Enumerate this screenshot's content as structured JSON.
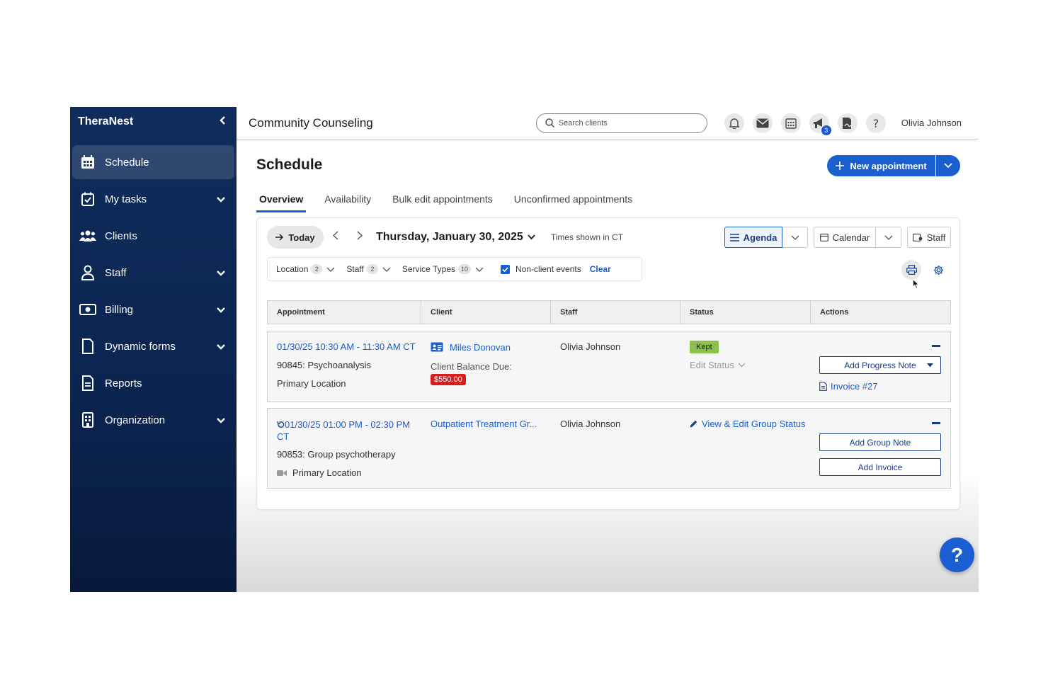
{
  "brand": "TheraNest",
  "sidebar": {
    "items": [
      {
        "label": "Schedule",
        "icon": "calendar-grid-icon",
        "active": true,
        "has_children": false
      },
      {
        "label": "My tasks",
        "icon": "calendar-check-icon",
        "active": false,
        "has_children": true
      },
      {
        "label": "Clients",
        "icon": "people-icon",
        "active": false,
        "has_children": false
      },
      {
        "label": "Staff",
        "icon": "person-icon",
        "active": false,
        "has_children": true
      },
      {
        "label": "Billing",
        "icon": "cash-icon",
        "active": false,
        "has_children": true
      },
      {
        "label": "Dynamic forms",
        "icon": "document-icon",
        "active": false,
        "has_children": true
      },
      {
        "label": "Reports",
        "icon": "report-icon",
        "active": false,
        "has_children": false
      },
      {
        "label": "Organization",
        "icon": "building-icon",
        "active": false,
        "has_children": true
      }
    ]
  },
  "topbar": {
    "org_name": "Community Counseling",
    "search_placeholder": "Search clients",
    "notification_badge": "3",
    "user_name": "Olivia Johnson"
  },
  "page": {
    "title": "Schedule",
    "new_appointment_label": "New appointment",
    "tabs": [
      "Overview",
      "Availability",
      "Bulk edit appointments",
      "Unconfirmed appointments"
    ]
  },
  "toolbar": {
    "today_label": "Today",
    "date_label": "Thursday, January 30, 2025",
    "timezone_note": "Times shown in CT",
    "views": {
      "agenda": "Agenda",
      "calendar": "Calendar",
      "staff": "Staff"
    }
  },
  "filters": {
    "location_label": "Location",
    "location_count": "2",
    "staff_label": "Staff",
    "staff_count": "2",
    "service_types_label": "Service Types",
    "service_types_count": "10",
    "non_client_label": "Non-client events",
    "clear_label": "Clear"
  },
  "table": {
    "headers": [
      "Appointment",
      "Client",
      "Staff",
      "Status",
      "Actions"
    ],
    "rows": [
      {
        "time": "01/30/25 10:30 AM - 11:30 AM CT",
        "service": "90845: Psychoanalysis",
        "location": "Primary Location",
        "client": "Miles Donovan",
        "balance_label": "Client Balance Due:",
        "balance": "$550.00",
        "staff": "Olivia Johnson",
        "status": "Kept",
        "edit_status": "Edit Status",
        "action_primary": "Add Progress Note",
        "invoice": "Invoice #27"
      },
      {
        "time": "01/30/25 01:00 PM - 02:30 PM",
        "time_tz": "CT",
        "service": "90853: Group psychotherapy",
        "location": "Primary Location",
        "client": "Outpatient Treatment Gr...",
        "staff": "Olivia Johnson",
        "status_link": "View & Edit Group Status",
        "action_primary": "Add Group Note",
        "action_secondary": "Add Invoice"
      }
    ]
  },
  "colors": {
    "sidebar_bg": "#0f2d5c",
    "accent": "#1a5fd0",
    "kept": "#8bc34a",
    "balance_due": "#d71e1e"
  }
}
